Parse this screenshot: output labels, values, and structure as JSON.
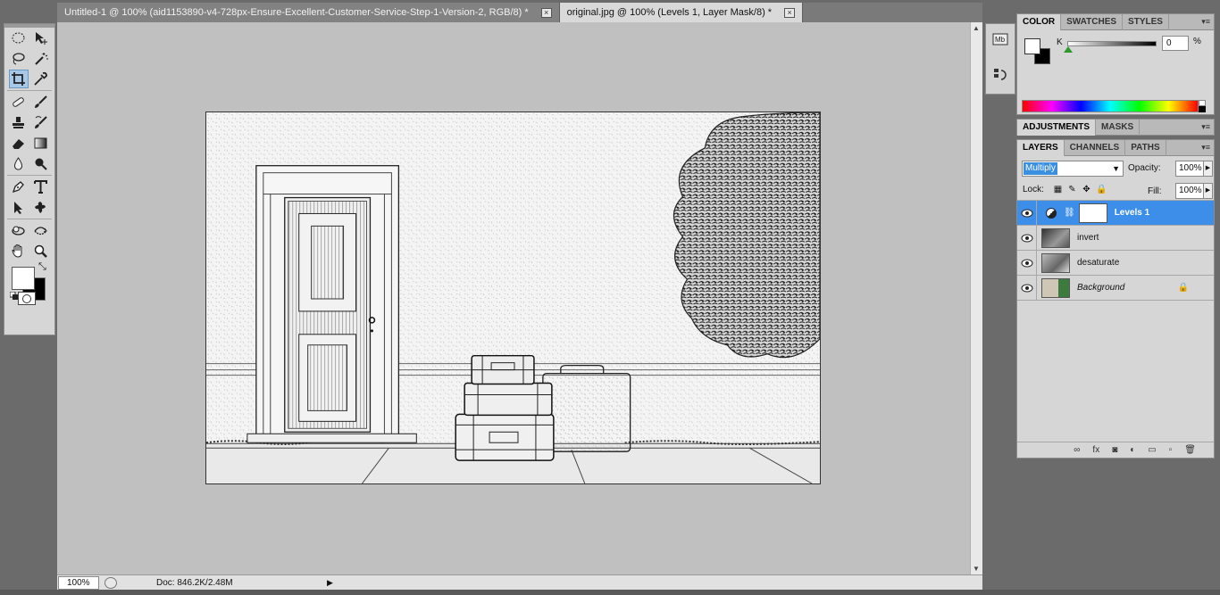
{
  "documents": {
    "tabs": [
      {
        "title": "Untitled-1 @ 100% (aid1153890-v4-728px-Ensure-Excellent-Customer-Service-Step-1-Version-2, RGB/8) *",
        "active": false
      },
      {
        "title": "original.jpg @ 100% (Levels 1, Layer Mask/8) *",
        "active": true
      }
    ],
    "close_glyph": "×"
  },
  "status": {
    "zoom": "100%",
    "doc_info": "Doc: 846.2K/2.48M",
    "arrow": "▶"
  },
  "tools": {
    "swap_glyph": "⤡"
  },
  "color_panel": {
    "tabs": [
      "COLOR",
      "SWATCHES",
      "STYLES"
    ],
    "channel_label": "K",
    "channel_value": "0",
    "unit": "%",
    "channel_level": 0
  },
  "adjustments_panel": {
    "tabs": [
      "ADJUSTMENTS",
      "MASKS"
    ]
  },
  "layers_panel": {
    "tabs": [
      "LAYERS",
      "CHANNELS",
      "PATHS"
    ],
    "blend_mode": "Multiply",
    "opacity_label": "Opacity:",
    "opacity": "100%",
    "lock_label": "Lock:",
    "fill_label": "Fill:",
    "fill": "100%",
    "layers": [
      {
        "name": "Levels 1",
        "selected": true,
        "italic": false
      },
      {
        "name": "invert",
        "selected": false,
        "italic": false
      },
      {
        "name": "desaturate",
        "selected": false,
        "italic": false
      },
      {
        "name": "Background",
        "selected": false,
        "italic": true,
        "locked": true
      }
    ],
    "footer_icons": [
      "link-icon",
      "fx-icon",
      "mask-icon",
      "adjustment-icon",
      "group-icon",
      "new-layer-icon",
      "trash-icon"
    ],
    "footer_glyphs": [
      "∞",
      "fx",
      "◙",
      "◐",
      "▭",
      "▫",
      "🗑"
    ]
  },
  "menu_glyph": "▾≡",
  "colors": {
    "selection_blue": "#3d8ee8",
    "panel_bg": "#d6d6d6",
    "canvas_bg": "#c0c0c0"
  }
}
